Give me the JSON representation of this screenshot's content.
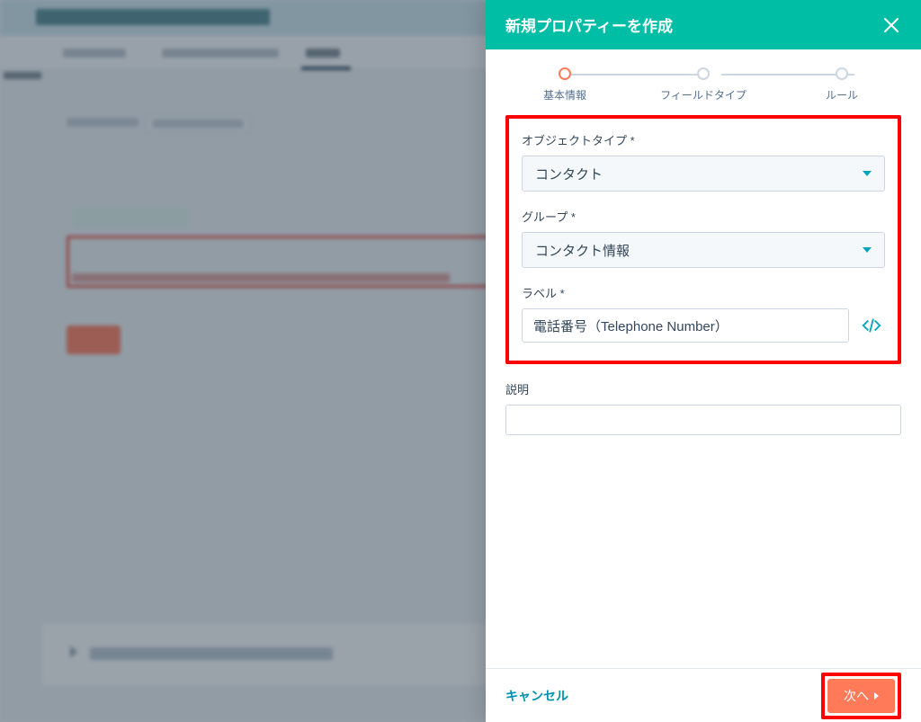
{
  "panel": {
    "title": "新規プロパティーを作成",
    "steps": [
      "基本情報",
      "フィールドタイプ",
      "ルール"
    ],
    "active_step_index": 0,
    "object_type": {
      "label": "オブジェクトタイプ *",
      "value": "コンタクト"
    },
    "group": {
      "label": "グループ *",
      "value": "コンタクト情報"
    },
    "label_field": {
      "label": "ラベル *",
      "value": "電話番号（Telephone Number）"
    },
    "description": {
      "label": "説明",
      "value": ""
    },
    "cancel": "キャンセル",
    "next": "次へ"
  },
  "colors": {
    "teal_header": "#00bda5",
    "accent_orange": "#ff7a59",
    "link": "#0091ae"
  }
}
